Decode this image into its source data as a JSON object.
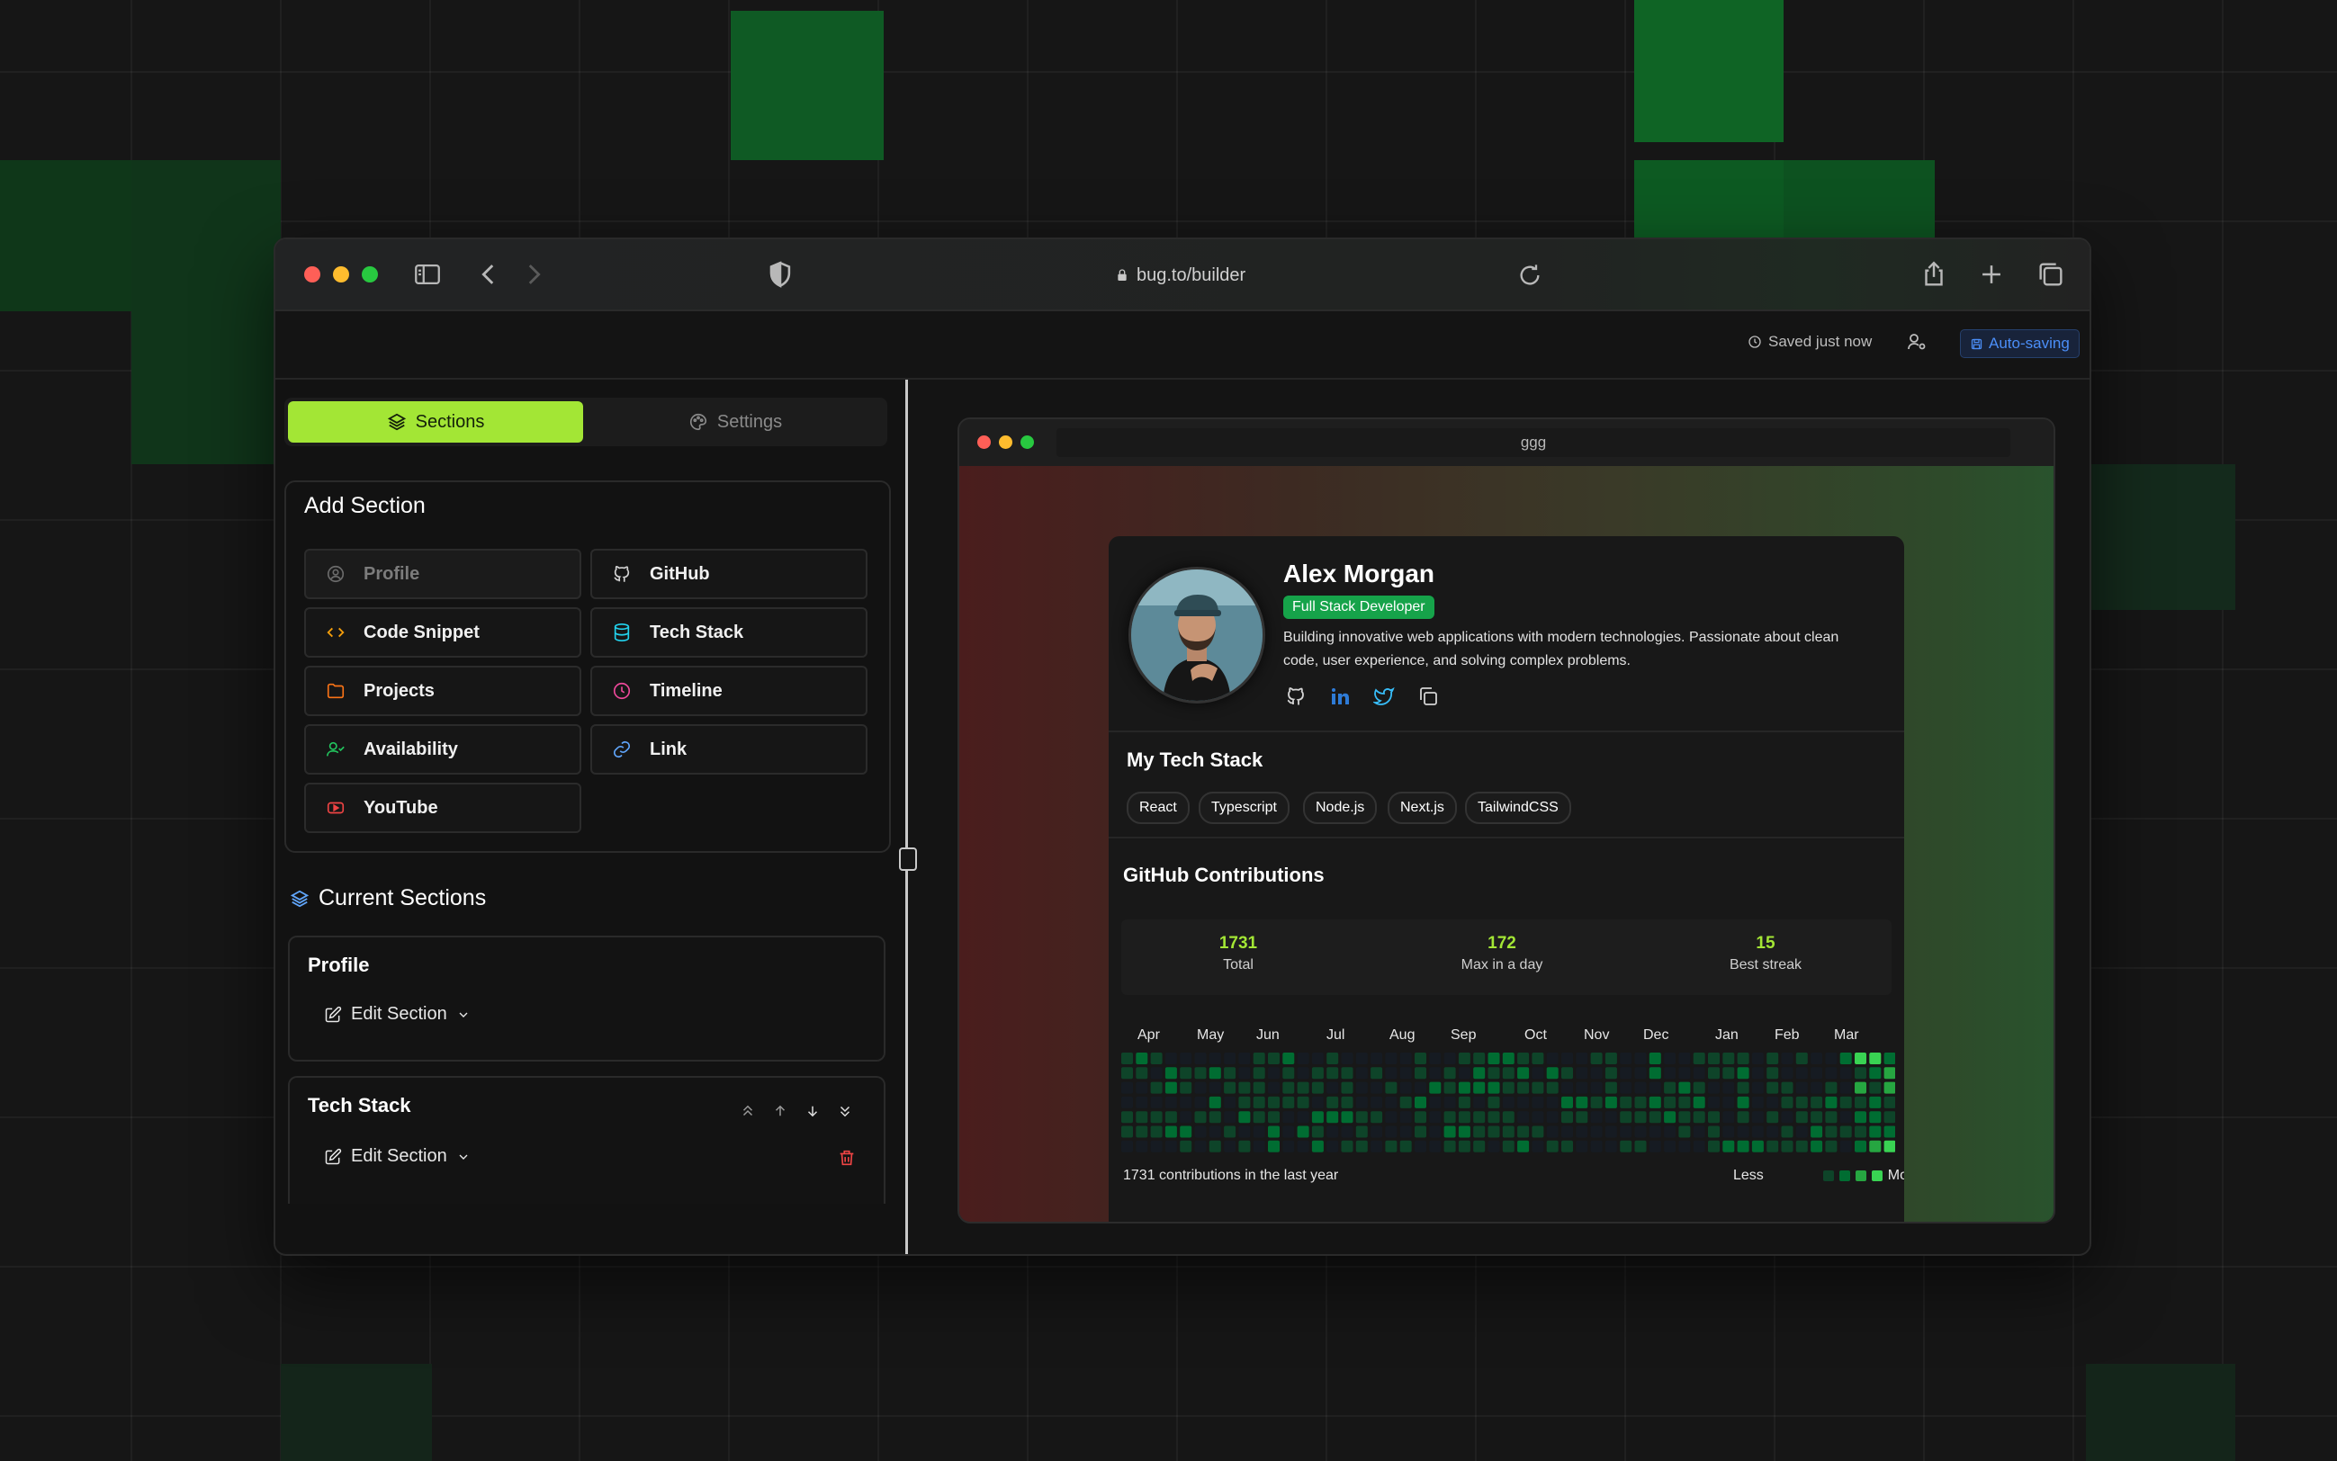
{
  "browser": {
    "url": "bug.to/builder"
  },
  "toolbar": {
    "saved": "Saved just now",
    "autosave": "Auto-saving"
  },
  "tabs": {
    "sections": "Sections",
    "settings": "Settings"
  },
  "add_section": {
    "title": "Add Section",
    "buttons": [
      {
        "label": "Profile",
        "icon": "user-circle-icon",
        "color": "#6b6b6b"
      },
      {
        "label": "GitHub",
        "icon": "github-icon",
        "color": "#d4d4d4"
      },
      {
        "label": "Code Snippet",
        "icon": "code-icon",
        "color": "#f59e0b"
      },
      {
        "label": "Tech Stack",
        "icon": "database-icon",
        "color": "#22d3ee"
      },
      {
        "label": "Projects",
        "icon": "folder-icon",
        "color": "#f97316"
      },
      {
        "label": "Timeline",
        "icon": "clock-icon",
        "color": "#ec4899"
      },
      {
        "label": "Availability",
        "icon": "user-check-icon",
        "color": "#22c55e"
      },
      {
        "label": "Link",
        "icon": "link-icon",
        "color": "#60a5fa"
      },
      {
        "label": "YouTube",
        "icon": "youtube-icon",
        "color": "#ef4444"
      }
    ]
  },
  "current_sections": {
    "title": "Current Sections",
    "edit_label": "Edit Section",
    "items": [
      {
        "title": "Profile"
      },
      {
        "title": "Tech Stack"
      }
    ]
  },
  "preview": {
    "url": "ggg",
    "name": "Alex Morgan",
    "role": "Full Stack Developer",
    "bio": "Building innovative web applications with modern technologies. Passionate about clean code, user experience, and solving complex problems.",
    "stack_title": "My Tech Stack",
    "stack": [
      "React",
      "Typescript",
      "Node.js",
      "Next.js",
      "TailwindCSS"
    ],
    "github": {
      "title": "GitHub Contributions",
      "stats": [
        {
          "value": "1731",
          "label": "Total"
        },
        {
          "value": "172",
          "label": "Max in a day"
        },
        {
          "value": "15",
          "label": "Best streak"
        }
      ],
      "months": [
        "Apr",
        "May",
        "Jun",
        "Jul",
        "Aug",
        "Sep",
        "Oct",
        "Nov",
        "Dec",
        "Jan",
        "Feb",
        "Mar"
      ],
      "summary": "1731 contributions in the last year",
      "less": "Less",
      "more": "More"
    }
  },
  "colors": {
    "accent": "#a3e635",
    "badge": "#16a34a",
    "autosave": "#4b8ef7"
  }
}
